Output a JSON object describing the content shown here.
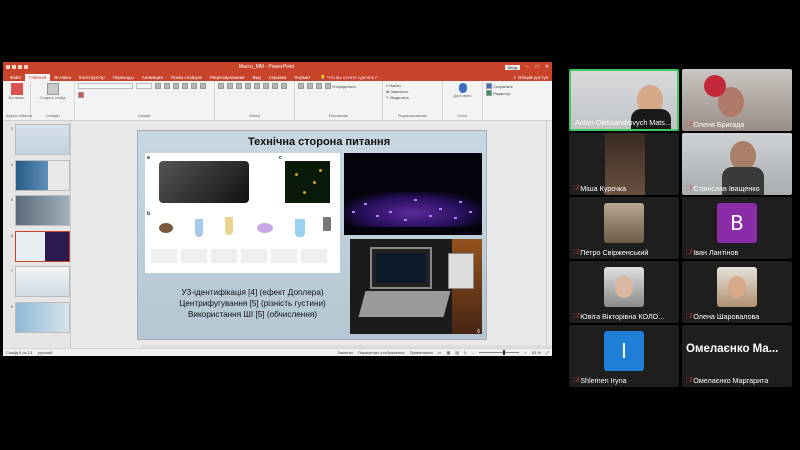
{
  "ppt": {
    "filename": "Macro_MM - PowerPoint",
    "badge": "Вход",
    "tabs": [
      "Файл",
      "Главная",
      "Вставка",
      "Конструктор",
      "Переходы",
      "Анимация",
      "Показ слайдов",
      "Рецензирование",
      "Вид",
      "Справка",
      "Формат"
    ],
    "active_tab_index": 1,
    "search_label": "Что вы хотите сделать?",
    "share_label": "Общий доступ",
    "ribbon_groups": [
      "Буфер обмена",
      "Слайды",
      "Шрифт",
      "Абзац",
      "Рисование",
      "Редактирование",
      "Голос"
    ],
    "ribbon_items": {
      "paste": "Вставить",
      "new_slide": "Создать слайд",
      "arrange": "Упорядочить",
      "find": "Найти",
      "replace": "Заменить",
      "select": "Выделить",
      "dictate": "Диктовать",
      "save_as": "Сохранить",
      "editor": "Редактор"
    },
    "thumb_numbers": [
      "3",
      "4",
      "5",
      "6",
      "7",
      "8"
    ],
    "selected_thumb": "6",
    "slide": {
      "title": "Технічна сторона питання",
      "lines": [
        "УЗ-ідентифікація [4] (ефект Доплера)",
        "Центрифугування [5] (різність густини)",
        "Використання ШІ [5] (обчислення)"
      ],
      "number": "6",
      "fig_tags": [
        "a",
        "b",
        "c"
      ]
    },
    "status": {
      "slide_info": "Слайд 6 из 13",
      "language": "русский",
      "notes": "Заметки",
      "display_settings": "Параметры отображения",
      "comments": "Примечания",
      "zoom": "83 %"
    }
  },
  "participants": [
    {
      "name": "Anton Oleksandrovych Mats...",
      "type": "video",
      "active": true
    },
    {
      "name": "Олена Бригада",
      "type": "video",
      "muted": true
    },
    {
      "name": "Міша Курочка",
      "type": "video",
      "muted": true
    },
    {
      "name": "Станіслав Іващенко",
      "type": "video",
      "muted": true
    },
    {
      "name": "Петро Свірженський",
      "type": "photo",
      "muted": true
    },
    {
      "name": "Іван Лантінов",
      "type": "letter",
      "letter": "B",
      "muted": true
    },
    {
      "name": "Ювіта Вікторівна КОЛО...",
      "type": "photo",
      "muted": true
    },
    {
      "name": "Олена Шаровалова",
      "type": "photo",
      "muted": true
    },
    {
      "name": "Shlemen Iryna",
      "type": "letter",
      "letter": "I",
      "muted": true
    },
    {
      "name": "Омелаєнко Маргарита",
      "type": "textname",
      "big_name": "Омелаєнко Ма...",
      "muted": true
    }
  ],
  "colors": {
    "ppt_accent": "#c8432a",
    "active_speaker": "#3fca5c",
    "mic_muted": "#e23a3a"
  }
}
